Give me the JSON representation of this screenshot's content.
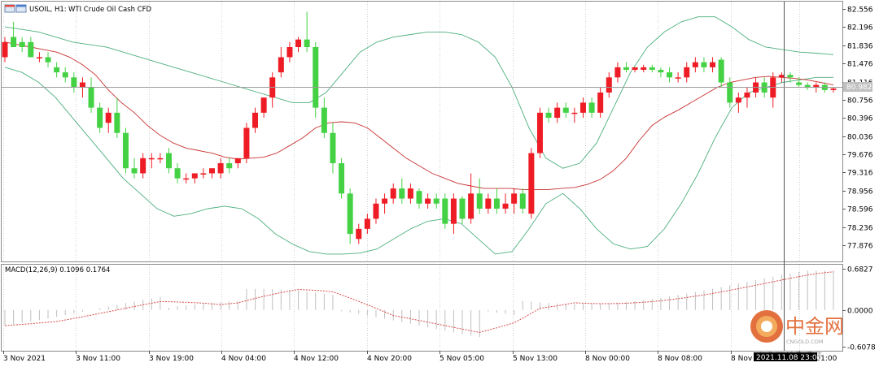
{
  "header": {
    "symbol": "USOIL, H1:",
    "description": "WTI Crude Oil Cash CFD",
    "symbol_icon": "chart-window-icon"
  },
  "macd": {
    "label": "MACD(12,26,9) 0.1096 0.1764",
    "axis_ticks": [
      "0.6827",
      "0.0000",
      "-0.6078"
    ],
    "histogram_color": "#c0c0c0",
    "signal_color": "#d84a4a"
  },
  "current_price_label": "80.982",
  "crosshair_time_label": "2021.11.08 23:00",
  "watermark": {
    "text": "中金网",
    "subtext": "CNGOLD.COM",
    "tagline": "中 金 财 经 新 媒 体",
    "icon": "cngold-logo-icon"
  },
  "colors": {
    "bull": "#ee1c24",
    "bear": "#44d244",
    "ma": "#c83232",
    "bands": "#4caf7d",
    "grid": "#d0d0d0"
  },
  "chart_data": {
    "type": "candlestick",
    "y_ticks": [
      "82.556",
      "82.196",
      "81.836",
      "81.476",
      "81.116",
      "80.756",
      "80.396",
      "80.036",
      "79.676",
      "79.316",
      "78.956",
      "78.596",
      "78.236",
      "77.876"
    ],
    "x_ticks": [
      "3 Nov 2021",
      "3 Nov 11:00",
      "3 Nov 19:00",
      "4 Nov 04:00",
      "4 Nov 12:00",
      "4 Nov 20:00",
      "5 Nov 05:00",
      "5 Nov 13:00",
      "8 Nov 00:00",
      "8 Nov 08:00",
      "8 Nov",
      "Nov 01:00"
    ],
    "ylim": [
      77.6,
      82.7
    ],
    "indicators": [
      "Bollinger Bands",
      "Moving Average"
    ],
    "grid": true,
    "candles": [
      {
        "o": 81.6,
        "h": 82.0,
        "l": 81.5,
        "c": 81.9
      },
      {
        "o": 82.0,
        "h": 82.3,
        "l": 81.8,
        "c": 81.8
      },
      {
        "o": 81.9,
        "h": 82.0,
        "l": 81.7,
        "c": 81.8
      },
      {
        "o": 81.9,
        "h": 82.0,
        "l": 81.6,
        "c": 81.6
      },
      {
        "o": 81.6,
        "h": 81.7,
        "l": 81.5,
        "c": 81.6
      },
      {
        "o": 81.6,
        "h": 81.7,
        "l": 81.4,
        "c": 81.5
      },
      {
        "o": 81.4,
        "h": 81.5,
        "l": 81.2,
        "c": 81.3
      },
      {
        "o": 81.3,
        "h": 81.4,
        "l": 81.1,
        "c": 81.2
      },
      {
        "o": 81.2,
        "h": 81.3,
        "l": 80.9,
        "c": 81.0
      },
      {
        "o": 81.0,
        "h": 81.2,
        "l": 80.8,
        "c": 81.1
      },
      {
        "o": 81.0,
        "h": 81.2,
        "l": 80.5,
        "c": 80.6
      },
      {
        "o": 80.6,
        "h": 80.7,
        "l": 80.1,
        "c": 80.2
      },
      {
        "o": 80.3,
        "h": 80.6,
        "l": 80.1,
        "c": 80.5
      },
      {
        "o": 80.5,
        "h": 80.8,
        "l": 80.0,
        "c": 80.1
      },
      {
        "o": 80.1,
        "h": 80.2,
        "l": 79.3,
        "c": 79.4
      },
      {
        "o": 79.4,
        "h": 79.6,
        "l": 79.2,
        "c": 79.3
      },
      {
        "o": 79.3,
        "h": 79.7,
        "l": 79.2,
        "c": 79.6
      },
      {
        "o": 79.6,
        "h": 79.7,
        "l": 79.4,
        "c": 79.6
      },
      {
        "o": 79.6,
        "h": 79.7,
        "l": 79.5,
        "c": 79.6
      },
      {
        "o": 79.7,
        "h": 79.8,
        "l": 79.3,
        "c": 79.4
      },
      {
        "o": 79.4,
        "h": 79.5,
        "l": 79.1,
        "c": 79.2
      },
      {
        "o": 79.2,
        "h": 79.3,
        "l": 79.1,
        "c": 79.2
      },
      {
        "o": 79.2,
        "h": 79.3,
        "l": 79.1,
        "c": 79.3
      },
      {
        "o": 79.3,
        "h": 79.4,
        "l": 79.2,
        "c": 79.3
      },
      {
        "o": 79.3,
        "h": 79.4,
        "l": 79.2,
        "c": 79.4
      },
      {
        "o": 79.3,
        "h": 79.6,
        "l": 79.2,
        "c": 79.5
      },
      {
        "o": 79.5,
        "h": 79.6,
        "l": 79.3,
        "c": 79.4
      },
      {
        "o": 79.5,
        "h": 79.6,
        "l": 79.4,
        "c": 79.6
      },
      {
        "o": 79.6,
        "h": 80.3,
        "l": 79.5,
        "c": 80.2
      },
      {
        "o": 80.2,
        "h": 80.6,
        "l": 80.1,
        "c": 80.5
      },
      {
        "o": 80.5,
        "h": 80.8,
        "l": 80.4,
        "c": 80.8
      },
      {
        "o": 80.8,
        "h": 81.3,
        "l": 80.6,
        "c": 81.2
      },
      {
        "o": 81.3,
        "h": 81.8,
        "l": 81.2,
        "c": 81.6
      },
      {
        "o": 81.6,
        "h": 81.9,
        "l": 81.5,
        "c": 81.8
      },
      {
        "o": 81.8,
        "h": 82.0,
        "l": 81.7,
        "c": 81.95
      },
      {
        "o": 81.95,
        "h": 82.5,
        "l": 81.7,
        "c": 81.8
      },
      {
        "o": 81.8,
        "h": 81.9,
        "l": 80.4,
        "c": 80.6
      },
      {
        "o": 80.6,
        "h": 80.8,
        "l": 80.0,
        "c": 80.1
      },
      {
        "o": 80.1,
        "h": 80.3,
        "l": 79.3,
        "c": 79.5
      },
      {
        "o": 79.5,
        "h": 79.6,
        "l": 78.8,
        "c": 78.9
      },
      {
        "o": 78.9,
        "h": 79.0,
        "l": 77.9,
        "c": 78.1
      },
      {
        "o": 78.0,
        "h": 78.3,
        "l": 77.9,
        "c": 78.2
      },
      {
        "o": 78.2,
        "h": 78.5,
        "l": 78.1,
        "c": 78.4
      },
      {
        "o": 78.4,
        "h": 78.8,
        "l": 78.3,
        "c": 78.7
      },
      {
        "o": 78.7,
        "h": 78.9,
        "l": 78.5,
        "c": 78.8
      },
      {
        "o": 78.8,
        "h": 79.1,
        "l": 78.7,
        "c": 79.0
      },
      {
        "o": 79.0,
        "h": 79.2,
        "l": 78.7,
        "c": 78.8
      },
      {
        "o": 78.8,
        "h": 79.1,
        "l": 78.7,
        "c": 79.0
      },
      {
        "o": 78.95,
        "h": 79.0,
        "l": 78.6,
        "c": 78.7
      },
      {
        "o": 78.7,
        "h": 78.9,
        "l": 78.6,
        "c": 78.8
      },
      {
        "o": 78.8,
        "h": 78.9,
        "l": 78.6,
        "c": 78.7
      },
      {
        "o": 78.8,
        "h": 78.9,
        "l": 78.2,
        "c": 78.3
      },
      {
        "o": 78.3,
        "h": 78.9,
        "l": 78.1,
        "c": 78.8
      },
      {
        "o": 78.8,
        "h": 78.85,
        "l": 78.3,
        "c": 78.4
      },
      {
        "o": 78.4,
        "h": 79.3,
        "l": 78.3,
        "c": 78.9
      },
      {
        "o": 78.9,
        "h": 79.2,
        "l": 78.5,
        "c": 78.6
      },
      {
        "o": 78.6,
        "h": 78.9,
        "l": 78.5,
        "c": 78.8
      },
      {
        "o": 78.8,
        "h": 79.0,
        "l": 78.5,
        "c": 78.6
      },
      {
        "o": 78.6,
        "h": 78.9,
        "l": 78.5,
        "c": 78.7
      },
      {
        "o": 78.7,
        "h": 79.0,
        "l": 78.5,
        "c": 78.9
      },
      {
        "o": 78.9,
        "h": 79.0,
        "l": 78.5,
        "c": 78.6
      },
      {
        "o": 78.5,
        "h": 79.8,
        "l": 78.4,
        "c": 79.7
      },
      {
        "o": 79.7,
        "h": 80.6,
        "l": 79.6,
        "c": 80.5
      },
      {
        "o": 80.5,
        "h": 80.6,
        "l": 80.3,
        "c": 80.4
      },
      {
        "o": 80.4,
        "h": 80.7,
        "l": 80.3,
        "c": 80.6
      },
      {
        "o": 80.6,
        "h": 80.7,
        "l": 80.4,
        "c": 80.5
      },
      {
        "o": 80.5,
        "h": 80.6,
        "l": 80.3,
        "c": 80.5
      },
      {
        "o": 80.5,
        "h": 80.8,
        "l": 80.4,
        "c": 80.7
      },
      {
        "o": 80.7,
        "h": 80.8,
        "l": 80.4,
        "c": 80.5
      },
      {
        "o": 80.5,
        "h": 81.0,
        "l": 80.4,
        "c": 80.9
      },
      {
        "o": 80.9,
        "h": 81.3,
        "l": 80.8,
        "c": 81.2
      },
      {
        "o": 81.2,
        "h": 81.5,
        "l": 81.1,
        "c": 81.4
      },
      {
        "o": 81.4,
        "h": 81.5,
        "l": 81.3,
        "c": 81.35
      },
      {
        "o": 81.35,
        "h": 81.4,
        "l": 81.3,
        "c": 81.4
      },
      {
        "o": 81.35,
        "h": 81.45,
        "l": 81.3,
        "c": 81.4
      },
      {
        "o": 81.4,
        "h": 81.45,
        "l": 81.3,
        "c": 81.35
      },
      {
        "o": 81.35,
        "h": 81.4,
        "l": 81.2,
        "c": 81.3
      },
      {
        "o": 81.3,
        "h": 81.4,
        "l": 81.1,
        "c": 81.2
      },
      {
        "o": 81.2,
        "h": 81.3,
        "l": 81.1,
        "c": 81.2
      },
      {
        "o": 81.2,
        "h": 81.5,
        "l": 81.1,
        "c": 81.4
      },
      {
        "o": 81.4,
        "h": 81.6,
        "l": 81.3,
        "c": 81.5
      },
      {
        "o": 81.5,
        "h": 81.6,
        "l": 81.3,
        "c": 81.4
      },
      {
        "o": 81.4,
        "h": 81.6,
        "l": 81.3,
        "c": 81.5
      },
      {
        "o": 81.55,
        "h": 81.6,
        "l": 81.0,
        "c": 81.1
      },
      {
        "o": 81.1,
        "h": 81.2,
        "l": 80.6,
        "c": 80.7
      },
      {
        "o": 80.7,
        "h": 80.9,
        "l": 80.5,
        "c": 80.8
      },
      {
        "o": 80.8,
        "h": 81.0,
        "l": 80.6,
        "c": 80.9
      },
      {
        "o": 80.9,
        "h": 81.2,
        "l": 80.8,
        "c": 81.1
      },
      {
        "o": 81.1,
        "h": 81.2,
        "l": 80.8,
        "c": 80.9
      },
      {
        "o": 80.8,
        "h": 81.3,
        "l": 80.6,
        "c": 81.2
      },
      {
        "o": 81.2,
        "h": 81.3,
        "l": 81.1,
        "c": 81.25
      },
      {
        "o": 81.25,
        "h": 81.3,
        "l": 81.1,
        "c": 81.2
      },
      {
        "o": 81.1,
        "h": 81.2,
        "l": 81.0,
        "c": 81.05
      },
      {
        "o": 81.05,
        "h": 81.1,
        "l": 80.95,
        "c": 81.0
      },
      {
        "o": 81.0,
        "h": 81.1,
        "l": 80.9,
        "c": 81.05
      },
      {
        "o": 81.05,
        "h": 81.1,
        "l": 80.9,
        "c": 80.95
      },
      {
        "o": 80.95,
        "h": 81.0,
        "l": 80.9,
        "c": 80.98
      }
    ],
    "ma": [
      81.9,
      81.85,
      81.8,
      81.75,
      81.7,
      81.6,
      81.45,
      81.25,
      80.95,
      80.7,
      80.5,
      80.25,
      80.05,
      79.9,
      79.8,
      79.75,
      79.7,
      79.62,
      79.58,
      79.6,
      79.62,
      79.7,
      79.85,
      80.0,
      80.2,
      80.3,
      80.32,
      80.3,
      80.2,
      80.0,
      79.8,
      79.6,
      79.45,
      79.3,
      79.2,
      79.1,
      79.05,
      79.0,
      79.0,
      79.0,
      78.98,
      78.98,
      78.98,
      79.0,
      79.02,
      79.08,
      79.18,
      79.35,
      79.6,
      79.95,
      80.25,
      80.42,
      80.55,
      80.7,
      80.85,
      81.0,
      81.1,
      81.15,
      81.2,
      81.22,
      81.2,
      81.18,
      81.15,
      81.1,
      81.05
    ],
    "ma_start_index": 31,
    "ma_head": [
      81.9,
      81.85,
      81.8,
      81.75,
      81.7,
      81.6,
      81.45,
      81.25,
      80.95,
      80.7,
      80.5,
      80.25,
      80.05,
      79.9,
      79.8,
      79.75,
      79.7,
      79.62,
      79.58,
      79.6,
      79.62,
      79.7,
      79.85,
      80.0,
      80.2,
      80.3,
      80.32,
      80.3,
      80.2,
      80.0,
      79.8
    ],
    "bb_upper": [
      82.2,
      82.15,
      82.1,
      82.0,
      81.9,
      81.85,
      81.8,
      81.7,
      81.6,
      81.5,
      81.4,
      81.3,
      81.2,
      81.1,
      81.0,
      80.9,
      80.8,
      80.7,
      80.7,
      80.9,
      81.3,
      81.7,
      81.9,
      82.0,
      82.05,
      82.1,
      82.1,
      82.05,
      81.9,
      81.6,
      81.0,
      80.2,
      79.6,
      79.4,
      79.5,
      79.9,
      80.6,
      81.3,
      81.8,
      82.1,
      82.3,
      82.4,
      82.4,
      82.2,
      81.95,
      81.8,
      81.75,
      81.7,
      81.68,
      81.65
    ],
    "bb_lower": [
      81.4,
      81.3,
      81.1,
      80.8,
      80.4,
      80.0,
      79.6,
      79.2,
      78.9,
      78.6,
      78.45,
      78.5,
      78.6,
      78.65,
      78.6,
      78.4,
      78.1,
      77.9,
      77.75,
      77.7,
      77.7,
      77.72,
      77.8,
      78.0,
      78.2,
      78.35,
      78.4,
      78.3,
      78.0,
      77.7,
      77.75,
      78.2,
      78.7,
      78.9,
      78.6,
      78.2,
      77.9,
      77.8,
      77.85,
      78.2,
      78.7,
      79.3,
      80.0,
      80.6,
      80.9,
      81.0,
      81.1,
      81.15,
      81.2,
      81.2
    ]
  }
}
